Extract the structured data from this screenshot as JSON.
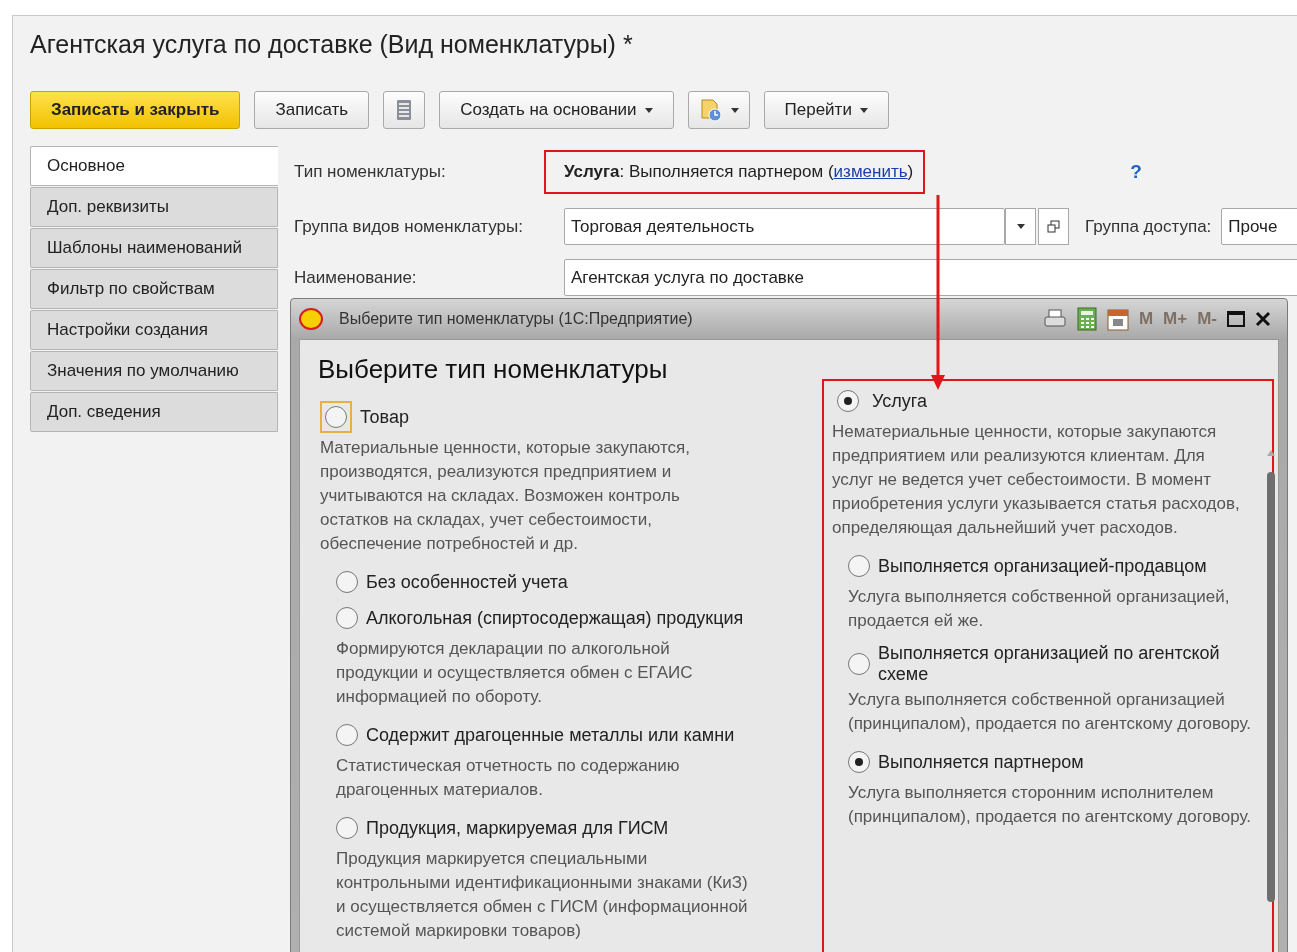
{
  "window": {
    "title": "Агентская услуга по доставке (Вид номенклатуры) *"
  },
  "toolbar": [
    {
      "kind": "primary",
      "label": "Записать и закрыть"
    },
    {
      "kind": "button",
      "label": "Записать"
    },
    {
      "kind": "list-icon"
    },
    {
      "kind": "dropdown",
      "label": "Создать на основании"
    },
    {
      "kind": "doc-icon-dropdown"
    },
    {
      "kind": "dropdown",
      "label": "Перейти"
    }
  ],
  "tabs": [
    {
      "label": "Основное",
      "selected": true
    },
    {
      "label": "Доп. реквизиты",
      "selected": false
    },
    {
      "label": "Шаблоны наименований",
      "selected": false
    },
    {
      "label": "Фильтр по свойствам",
      "selected": false
    },
    {
      "label": "Настройки создания",
      "selected": false
    },
    {
      "label": "Значения по умолчанию",
      "selected": false
    },
    {
      "label": "Доп. сведения",
      "selected": false
    }
  ],
  "type_field": {
    "label": "Тип номенклатуры:",
    "value": "**Услуга**: Выполняется партнером (",
    "link": "изменить",
    "suffix": ")",
    "highlighted": true,
    "help": "?"
  },
  "group_field": {
    "label": "Группа видов номенклатуры:",
    "value": "Торговая деятельность",
    "access_label": "Группа доступа:",
    "access_value": "Проче"
  },
  "name_field": {
    "label": "Наименование:",
    "value": "Агентская услуга по доставке"
  },
  "dialog": {
    "title": "Выберите тип номенклатуры  (1С:Предприятие)",
    "memory_buttons": [
      {
        "label": "M",
        "disabled": true
      },
      {
        "label": "M+",
        "disabled": true
      },
      {
        "label": "M-",
        "disabled": true
      }
    ],
    "heading": "Выберите тип номенклатуры",
    "options": [
      {
        "label": "Товар",
        "selected": false,
        "focused": true,
        "highlighted": false,
        "description": "Материальные ценности, которые закупаются, производятся, реализуются предприятием и учитываются на складах. Возможен контроль остатков на складах, учет себестоимости, обеспечение потребностей и др.",
        "children": [
          {
            "label": "Без особенностей учета",
            "selected": false
          },
          {
            "label": "Алкогольная (спиртосодержащая) продукция",
            "selected": false,
            "description": "Формируются декларации по алкогольной продукции и осуществляется обмен с ЕГАИС информацией по обороту."
          },
          {
            "label": "Содержит драгоценные металлы или камни",
            "selected": false,
            "description": "Статистическая отчетность по содержанию драгоценных материалов."
          },
          {
            "label": "Продукция, маркируемая для ГИСМ",
            "selected": false,
            "description": "Продукция маркируется специальными контрольными идентификационными знаками (КиЗ) и осуществляется обмен с ГИСМ (информационной системой маркировки товаров)"
          }
        ]
      },
      {
        "label": "Услуга",
        "selected": true,
        "focused": false,
        "highlighted": true,
        "description": "Нематериальные ценности, которые закупаются предприятием или реализуются клиентам. Для услуг не ведется учет себестоимости. В момент приобретения услуги указывается статья расходов, определяющая дальнейший учет расходов.",
        "children": [
          {
            "label": "Выполняется организацией-продавцом",
            "selected": false,
            "description": "Услуга выполняется собственной организацией, продается ей же."
          },
          {
            "label": "Выполняется организацией по агентской схеме",
            "selected": false,
            "description": "Услуга выполняется собственной организацией (принципалом), продается по агентскому договору."
          },
          {
            "label": "Выполняется партнером",
            "selected": true,
            "description": "Услуга выполняется сторонним исполнителем (принципалом), продается по агентскому договору."
          }
        ]
      }
    ]
  }
}
